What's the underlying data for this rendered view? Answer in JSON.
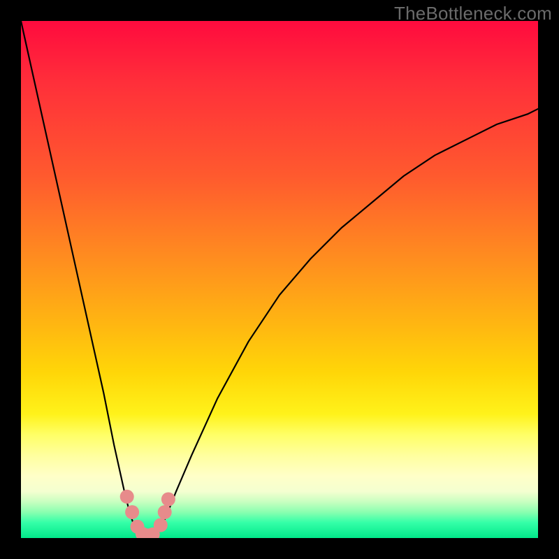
{
  "watermark": "TheBottleneck.com",
  "chart_data": {
    "type": "line",
    "title": "",
    "xlabel": "",
    "ylabel": "",
    "xlim": [
      0,
      100
    ],
    "ylim": [
      0,
      100
    ],
    "grid": false,
    "series": [
      {
        "name": "bottleneck-curve",
        "x": [
          0,
          2,
          4,
          6,
          8,
          10,
          12,
          14,
          16,
          18,
          20,
          21,
          22,
          23,
          24,
          25,
          26,
          27,
          28,
          30,
          33,
          38,
          44,
          50,
          56,
          62,
          68,
          74,
          80,
          86,
          92,
          98,
          100
        ],
        "values": [
          100,
          91,
          82,
          73,
          64,
          55,
          46,
          37,
          28,
          18,
          9,
          5,
          2,
          0.5,
          0.3,
          0.4,
          0.8,
          2,
          4,
          9,
          16,
          27,
          38,
          47,
          54,
          60,
          65,
          70,
          74,
          77,
          80,
          82,
          83
        ]
      }
    ],
    "markers": {
      "name": "highlight-dots",
      "color": "#e78b8b",
      "points": [
        {
          "x": 20.5,
          "y": 8.0
        },
        {
          "x": 21.5,
          "y": 5.0
        },
        {
          "x": 22.5,
          "y": 2.2
        },
        {
          "x": 23.5,
          "y": 0.8
        },
        {
          "x": 24.5,
          "y": 0.5
        },
        {
          "x": 25.5,
          "y": 0.7
        },
        {
          "x": 27.0,
          "y": 2.5
        },
        {
          "x": 27.8,
          "y": 5.0
        },
        {
          "x": 28.5,
          "y": 7.5
        }
      ]
    }
  }
}
